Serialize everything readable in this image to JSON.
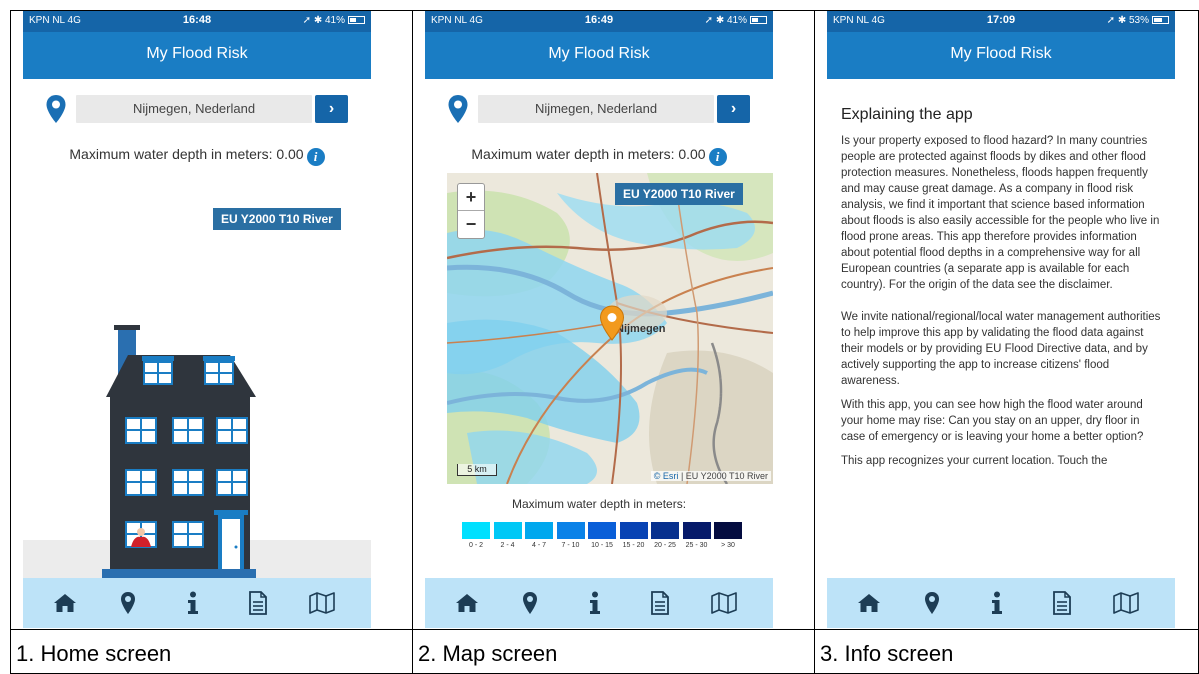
{
  "screens": [
    {
      "status": {
        "carrier": "KPN NL  4G",
        "time": "16:48",
        "battery": "41%"
      },
      "title": "My Flood Risk",
      "search": {
        "value": "Nijmegen, Nederland",
        "go": "›"
      },
      "depth_label": "Maximum water depth in meters: 0.00",
      "layer": "EU Y2000 T10 River",
      "caption": "1. Home screen"
    },
    {
      "status": {
        "carrier": "KPN NL  4G",
        "time": "16:49",
        "battery": "41%"
      },
      "title": "My Flood Risk",
      "search": {
        "value": "Nijmegen, Nederland",
        "go": "›"
      },
      "depth_label": "Maximum water depth in meters: 0.00",
      "layer": "EU Y2000 T10 River",
      "map": {
        "zoom_in": "+",
        "zoom_out": "−",
        "place_label": "Nijmegen",
        "scale": "5 km",
        "attribution_esri": "© Esri",
        "attribution_rest": " | EU Y2000 T10 River"
      },
      "legend": {
        "title": "Maximum water depth in meters:",
        "items": [
          {
            "label": "0 - 2",
            "color": "#00e0ff"
          },
          {
            "label": "2 - 4",
            "color": "#00c8f6"
          },
          {
            "label": "4 - 7",
            "color": "#00a8ee"
          },
          {
            "label": "7 - 10",
            "color": "#0a82e8"
          },
          {
            "label": "10 - 15",
            "color": "#0a5fd8"
          },
          {
            "label": "15 - 20",
            "color": "#0843b4"
          },
          {
            "label": "20 - 25",
            "color": "#07308e"
          },
          {
            "label": "25 - 30",
            "color": "#061a6a"
          },
          {
            "label": "> 30",
            "color": "#040c40"
          }
        ]
      },
      "caption": "2. Map screen"
    },
    {
      "status": {
        "carrier": "KPN NL  4G",
        "time": "17:09",
        "battery": "53%"
      },
      "title": "My Flood Risk",
      "heading": "Explaining the app",
      "paragraphs": [
        "Is your property exposed to flood hazard? In many countries people are protected against floods by dikes and other flood protection measures. Nonetheless, floods happen frequently and may cause great damage. As a company in flood risk analysis, we find it important that science based information about floods is also easily accessible for the people who live in flood prone areas. This app therefore provides information about potential flood depths in a comprehensive way for all European countries (a separate app is available for each country). For the origin of the data see the disclaimer.",
        "We invite national/regional/local water management authorities to help improve this app by validating the flood data against their models or by providing EU Flood Directive data, and by actively supporting the app to increase citizens' flood awareness.",
        "With this app, you can see how high the flood water around your home may rise: Can you stay on an upper, dry floor in case of emergency or is leaving your home a better option?",
        "This app recognizes your current location. Touch the"
      ],
      "caption": "3. Info screen"
    }
  ],
  "tabs": [
    "home-icon",
    "map-pin-icon",
    "info-icon",
    "document-icon",
    "map-icon"
  ],
  "colors": {
    "brand": "#1a7dc4",
    "statusbar": "#1565a8",
    "tabbar": "#bde3f8",
    "house": "#2f353d",
    "window": "#1a7dc4"
  }
}
